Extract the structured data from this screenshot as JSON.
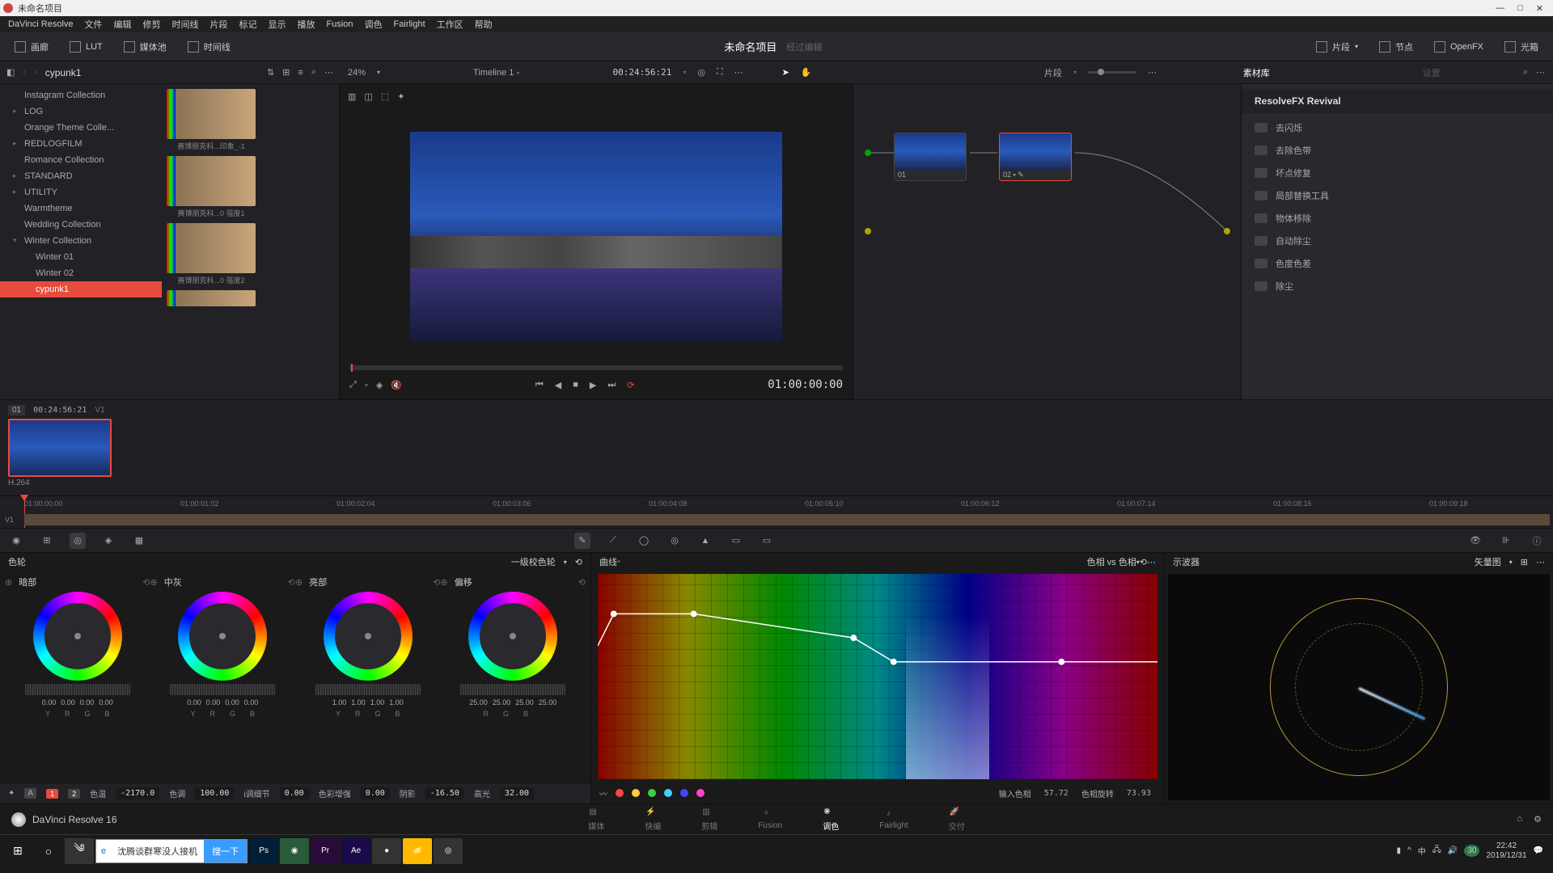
{
  "window": {
    "title": "未命名项目",
    "app": "DaVinci Resolve"
  },
  "menu": [
    "DaVinci Resolve",
    "文件",
    "编辑",
    "修剪",
    "时间线",
    "片段",
    "标记",
    "显示",
    "播放",
    "Fusion",
    "调色",
    "Fairlight",
    "工作区",
    "帮助"
  ],
  "toolbar": {
    "gallery": "画廊",
    "lut": "LUT",
    "media": "媒体池",
    "timeline": "时间线",
    "project": "未命名项目",
    "project_sub": "经过编辑",
    "clips": "片段",
    "nodes": "节点",
    "openfx": "OpenFX",
    "lightbox": "光箱"
  },
  "row2": {
    "path": "cypunk1",
    "zoom": "24%",
    "timeline": "Timeline 1",
    "tc": "00:24:56:21",
    "clips_drop": "片段",
    "lib": "素材库",
    "settings": "设置"
  },
  "tree": [
    {
      "label": "Instagram Collection"
    },
    {
      "label": "LOG",
      "exp": true
    },
    {
      "label": "Orange Theme Colle..."
    },
    {
      "label": "REDLOGFILM",
      "exp": true
    },
    {
      "label": "Romance Collection"
    },
    {
      "label": "STANDARD",
      "exp": true
    },
    {
      "label": "UTILITY",
      "exp": true
    },
    {
      "label": "Warmtheme"
    },
    {
      "label": "Wedding Collection"
    },
    {
      "label": "Winter Collection",
      "exp": true,
      "open": true
    },
    {
      "label": "Winter 01",
      "indent": true
    },
    {
      "label": "Winter 02",
      "indent": true
    },
    {
      "label": "cypunk1",
      "indent": true,
      "sel": true
    }
  ],
  "thumbs": [
    {
      "label": "赛博朋克科...印象_-1"
    },
    {
      "label": "赛博朋克科...0 强度1"
    },
    {
      "label": "赛博朋克科...0 强度2"
    }
  ],
  "viewer": {
    "tc": "01:00:00:00"
  },
  "nodes": [
    {
      "id": "01"
    },
    {
      "id": "02",
      "sel": true
    }
  ],
  "fx": {
    "title": "ResolveFX Revival",
    "items": [
      "去闪烁",
      "去除色带",
      "坏点修复",
      "局部替换工具",
      "物体移除",
      "自动除尘",
      "色度色差",
      "除尘"
    ]
  },
  "clip": {
    "badge": "01",
    "tc": "00:24:56:21",
    "track": "V1",
    "codec": "H.264"
  },
  "ruler": [
    "01:00:00:00",
    "01:00:01:02",
    "01:00:02:04",
    "01:00:03:06",
    "01:00:04:08",
    "01:00:05:10",
    "01:00:06:12",
    "01:00:07:14",
    "01:00:08:16",
    "01:00:09:18"
  ],
  "wheels": {
    "title": "色轮",
    "mode": "一级校色轮",
    "groups": [
      {
        "name": "暗部",
        "vals": [
          "0.00",
          "0.00",
          "0.00",
          "0.00"
        ],
        "labs": [
          "Y",
          "R",
          "G",
          "B"
        ]
      },
      {
        "name": "中灰",
        "vals": [
          "0.00",
          "0.00",
          "0.00",
          "0.00"
        ],
        "labs": [
          "Y",
          "R",
          "G",
          "B"
        ]
      },
      {
        "name": "亮部",
        "vals": [
          "1.00",
          "1.00",
          "1.00",
          "1.00"
        ],
        "labs": [
          "Y",
          "R",
          "G",
          "B"
        ]
      },
      {
        "name": "偏移",
        "vals": [
          "25.00",
          "25.00",
          "25.00",
          "25.00"
        ],
        "labs": [
          "R",
          "G",
          "B",
          ""
        ]
      }
    ]
  },
  "adj": {
    "n1": "1",
    "n2": "2",
    "temp_l": "色温",
    "temp_v": "-2170.0",
    "tint_l": "色调",
    "tint_v": "100.00",
    "detail_l": "i调细节",
    "detail_v": "0.00",
    "boost_l": "色彩增强",
    "boost_v": "0.00",
    "shadow_l": "阴影",
    "shadow_v": "-16.50",
    "high_l": "高光",
    "high_v": "32.00"
  },
  "curves": {
    "title": "曲线",
    "mode": "色相 vs 色相",
    "in_l": "输入色相",
    "in_v": "57.72",
    "rot_l": "色相旋转",
    "rot_v": "73.93"
  },
  "scopes": {
    "title": "示波器",
    "mode": "矢量图"
  },
  "pages": {
    "media": "媒体",
    "cut": "快编",
    "edit": "剪辑",
    "fusion": "Fusion",
    "color": "调色",
    "fairlight": "Fairlight",
    "deliver": "交付",
    "brand": "DaVinci Resolve 16"
  },
  "taskbar": {
    "search": "沈腾谈群寒没人接机",
    "search_btn": "搜一下",
    "time": "22:42",
    "date": "2019/12/31"
  }
}
